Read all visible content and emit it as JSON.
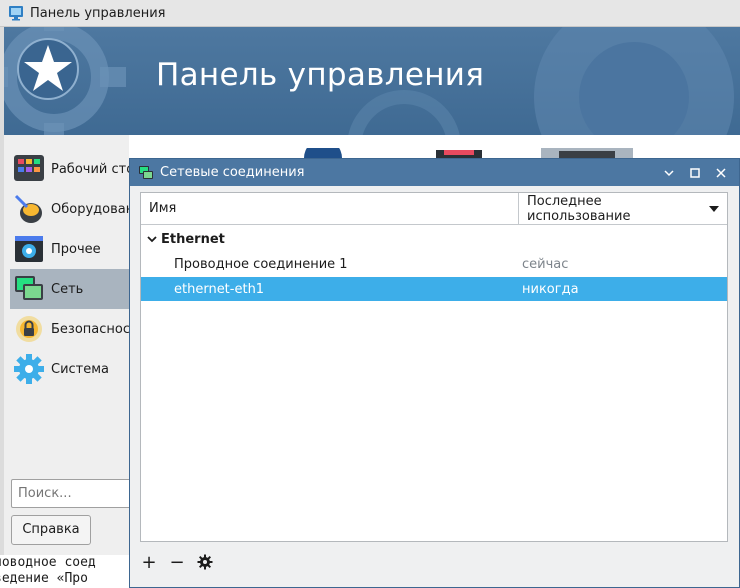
{
  "main_window": {
    "title": "Панель управления",
    "banner_title": "Панель управления"
  },
  "sidebar": {
    "items": [
      {
        "label": "Рабочий стол",
        "icon": "desktop-icon",
        "active": false
      },
      {
        "label": "Оборудование",
        "icon": "hardware-icon",
        "active": false
      },
      {
        "label": "Прочее",
        "icon": "misc-icon",
        "active": false
      },
      {
        "label": "Сеть",
        "icon": "network-icon",
        "active": true
      },
      {
        "label": "Безопасность",
        "icon": "security-icon",
        "active": false
      },
      {
        "label": "Система",
        "icon": "system-gear-icon",
        "active": false
      }
    ]
  },
  "search": {
    "value": "",
    "placeholder": "Поиск..."
  },
  "help_button": {
    "label": "Справка"
  },
  "console": {
    "lines": [
      "ловодное соед",
      "ведение «Про"
    ]
  },
  "dialog": {
    "title": "Сетевые соединения",
    "columns": {
      "name": "Имя",
      "last_used": "Последнее использование"
    },
    "group": "Ethernet",
    "rows": [
      {
        "name": "Проводное соединение 1",
        "last_used": "сейчас"
      },
      {
        "name": "ethernet-eth1",
        "last_used": "никогда"
      }
    ],
    "toolbar": {
      "add": "+",
      "remove": "−",
      "settings_icon": "gear-icon"
    }
  },
  "colors": {
    "banner": "#4e78a0",
    "dialog_titlebar": "#4c77a2",
    "selection": "#3daee9",
    "sidebar_active": "#a9b4bf"
  }
}
